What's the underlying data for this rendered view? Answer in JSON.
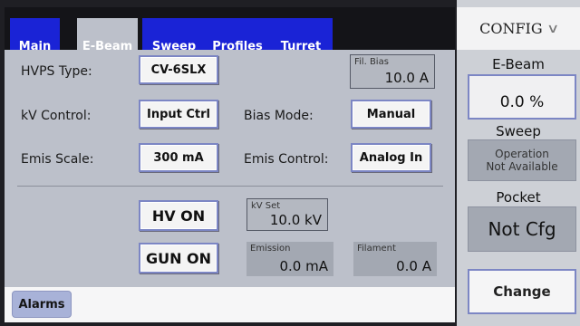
{
  "tabs": [
    {
      "label": "Main"
    },
    {
      "label": "E-Beam"
    },
    {
      "label": "Sweep"
    },
    {
      "label": "Profiles"
    },
    {
      "label": "Turret"
    }
  ],
  "active_tab": "E-Beam",
  "ebeam": {
    "hvps_type_label": "HVPS Type:",
    "hvps_type_value": "CV-6SLX",
    "kv_control_label": "kV Control:",
    "kv_control_value": "Input Ctrl",
    "bias_mode_label": "Bias Mode:",
    "bias_mode_value": "Manual",
    "emis_scale_label": "Emis Scale:",
    "emis_scale_value": "300 mA",
    "emis_control_label": "Emis Control:",
    "emis_control_value": "Analog In",
    "fil_bias_caption": "Fil. Bias",
    "fil_bias_value": "10.0 A",
    "hv_on": "HV ON",
    "gun_on": "GUN ON",
    "kv_set_caption": "kV Set",
    "kv_set_value": "10.0 kV",
    "emission_caption": "Emission",
    "emission_value": "0.0 mA",
    "filament_caption": "Filament",
    "filament_value": "0.0 A"
  },
  "footer": {
    "alarms": "Alarms"
  },
  "config": {
    "header": "CONFIG",
    "chevron_icon": "double-chevron-down-icon",
    "ebeam_label": "E-Beam",
    "ebeam_value": "0.0 %",
    "sweep_label": "Sweep",
    "sweep_status_line1": "Operation",
    "sweep_status_line2": "Not Available",
    "pocket_label": "Pocket",
    "pocket_value": "Not Cfg",
    "change": "Change"
  },
  "colors": {
    "tab_blue": "#1a23d6",
    "panel_gray": "#bcc0ca",
    "readout_gray": "#a3a8b2",
    "button_border": "#7c86c4"
  }
}
